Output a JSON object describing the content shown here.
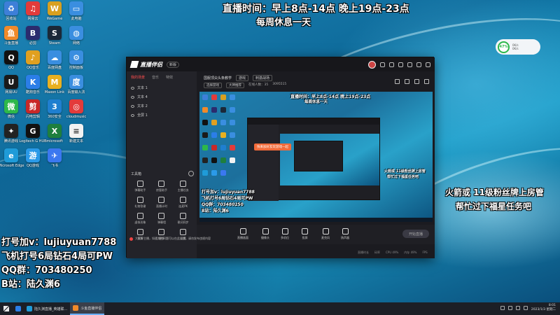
{
  "overlay": {
    "schedule_line1": "直播时间：早上8点-14点 晚上19点-23点",
    "schedule_line2": "每周休息一天",
    "right_line1": "火箭或 11级粉丝牌上房管",
    "right_line2": "帮忙过下福星任务吧",
    "left_lines": [
      "打号加v：lujiuyuan7788",
      "飞机打号6局钻石4局可PW",
      "QQ群：703480250",
      "B站：陆久渊6"
    ]
  },
  "desktop_icons": [
    {
      "label": "回收站",
      "color": "#3d7fd8",
      "glyph": "♻"
    },
    {
      "label": "网易云",
      "color": "#e33b3b",
      "glyph": "♫"
    },
    {
      "label": "WeGame",
      "color": "#d8a020",
      "glyph": "W"
    },
    {
      "label": "此电脑",
      "color": "#3a8ee0",
      "glyph": "▭"
    },
    {
      "label": "斗鱼直播",
      "color": "#f08a2a",
      "glyph": "鱼"
    },
    {
      "label": "必剪",
      "color": "#2b2b6e",
      "glyph": "B"
    },
    {
      "label": "Steam",
      "color": "#1b2838",
      "glyph": "S"
    },
    {
      "label": "网络",
      "color": "#3a8ee0",
      "glyph": "◍"
    },
    {
      "label": "QQ",
      "color": "#111111",
      "glyph": "Q"
    },
    {
      "label": "QQ音乐",
      "color": "#e0a020",
      "glyph": "♪"
    },
    {
      "label": "百度网盘",
      "color": "#3a8ee0",
      "glyph": "☁"
    },
    {
      "label": "控制面板",
      "color": "#3a8ee0",
      "glyph": "⚙"
    },
    {
      "label": "网易UU",
      "color": "#1a1a1a",
      "glyph": "U"
    },
    {
      "label": "酷狗音乐",
      "color": "#2b7ee8",
      "glyph": "K"
    },
    {
      "label": "Maxon Link",
      "color": "#e8b020",
      "glyph": "M"
    },
    {
      "label": "百度输入法",
      "color": "#3a8ee0",
      "glyph": "度"
    },
    {
      "label": "微信",
      "color": "#2db84a",
      "glyph": "微"
    },
    {
      "label": "闪电剪辑",
      "color": "#c82828",
      "glyph": "剪"
    },
    {
      "label": "360安全",
      "color": "#1f7fd0",
      "glyph": "3"
    },
    {
      "label": "cloudmusic",
      "color": "#e33b3b",
      "glyph": "◎"
    },
    {
      "label": "腾讯游戏",
      "color": "#222222",
      "glyph": "✦"
    },
    {
      "label": "Logitech G HUB",
      "color": "#111111",
      "glyph": "G"
    },
    {
      "label": "microsoft",
      "color": "#1e7f3e",
      "glyph": "X"
    },
    {
      "label": "新建文本",
      "color": "#f2f2f2",
      "glyph": "≡"
    },
    {
      "label": "Microsoft Edge",
      "color": "#1f9bd8",
      "glyph": "e"
    },
    {
      "label": "QQ游戏",
      "color": "#2b9ae8",
      "glyph": "游"
    },
    {
      "label": "飞书",
      "color": "#3b78f0",
      "glyph": "✈"
    }
  ],
  "app": {
    "title": "直播伴侣",
    "version_badge": "新版",
    "sidebar_tabs": [
      "我的场景",
      "音乐",
      "特效"
    ],
    "scenes": [
      "文本 1",
      "文本 4",
      "文本 2",
      "全屏 1"
    ],
    "tools_heading": "工具箱",
    "tools": [
      "弹幕助手",
      "房管助手",
      "主播任务",
      "礼物答谢",
      "直播计时",
      "连麦PK",
      "虚拟形象",
      "弹幕墙",
      "歌词同步",
      "投票",
      "更多",
      "设置"
    ],
    "notice": "大家好主播，如遇其他问题可以在此反馈，请勿发布违规内容",
    "room_title": "国服顶尖头条教学",
    "room_tags": [
      "游戏",
      "刺激战场"
    ],
    "room_info": [
      "选择游戏",
      "大神推荐",
      "在线人数：35",
      "3095515"
    ],
    "controls": [
      "直播画面",
      "摄像头",
      "多机位",
      "投屏",
      "麦克风",
      "扬声器"
    ],
    "go_live": "开始直播",
    "status": [
      "直播时长",
      "码率",
      "CPU 49%",
      "内存 49%",
      "FPS"
    ]
  },
  "preview": {
    "top1": "直播时间：早上8点-14点 晚上19点-23点",
    "top2": "每周休息一天",
    "right1": "火箭或 11级粉丝牌上房管",
    "right2": "帮忙过下福星任务吧",
    "banner": "快来加好友玩游戏一起",
    "left_lines": [
      "打号加v：lujiuyuan7788",
      "飞机打号6局钻石4局可PW",
      "QQ群：703480250",
      "B站：陆久渊6"
    ]
  },
  "widget": {
    "percent": "47%",
    "net_up": "0K/s",
    "net_down": "0K/s"
  },
  "taskbar": {
    "apps": [
      {
        "label": "陆久渊直播_英雄联...",
        "color": "#1f9bd8",
        "active": false
      },
      {
        "label": "斗鱼直播伴侣",
        "color": "#f08a2a",
        "active": true
      }
    ],
    "time": "8:01",
    "date": "2023/1/3 星期二"
  }
}
